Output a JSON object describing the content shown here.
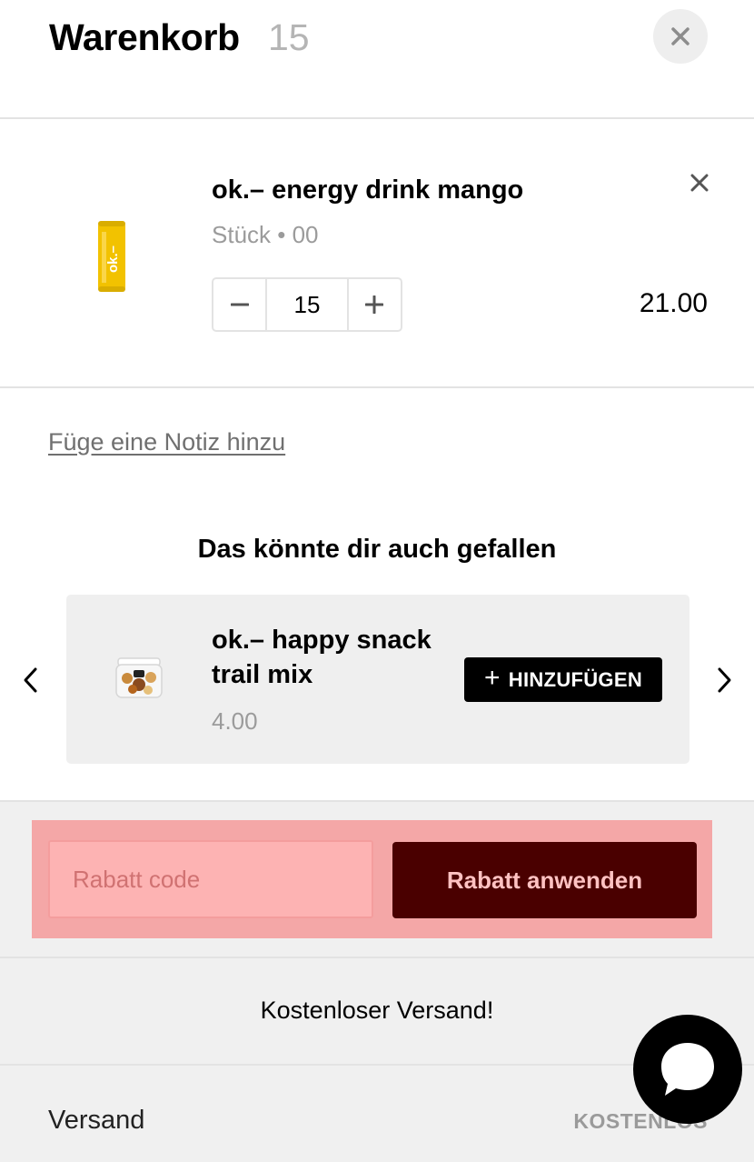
{
  "header": {
    "title": "Warenkorb",
    "count": "15",
    "close_icon": "close-icon"
  },
  "cart": {
    "items": [
      {
        "title": "ok.– energy drink mango",
        "variant": "Stück • 00",
        "quantity": "15",
        "price": "21.00",
        "image_icon": "energy-drink-can-icon",
        "remove_icon": "close-icon",
        "decrease_icon": "minus-icon",
        "increase_icon": "plus-icon"
      }
    ]
  },
  "note": {
    "link_label": "Füge eine Notiz hinzu"
  },
  "upsell": {
    "heading": "Das könnte dir auch gefallen",
    "product": {
      "title": "ok.– happy snack trail mix",
      "price": "4.00",
      "image_icon": "snack-jar-icon",
      "add_label": "HINZUFÜGEN",
      "add_icon": "plus-icon"
    },
    "prev_icon": "chevron-left-icon",
    "next_icon": "chevron-right-icon"
  },
  "discount": {
    "placeholder": "Rabatt code",
    "value": "",
    "button_label": "Rabatt anwenden"
  },
  "shipping": {
    "banner": "Kostenloser Versand!",
    "label": "Versand",
    "value": "KOSTENLOS"
  },
  "chat": {
    "icon": "chat-bubble-icon"
  },
  "colors": {
    "discount_highlight": "#f4a7a7",
    "discount_button": "#4a0000",
    "can_yellow": "#f2c200",
    "footer_bg": "#f0f0f0"
  }
}
